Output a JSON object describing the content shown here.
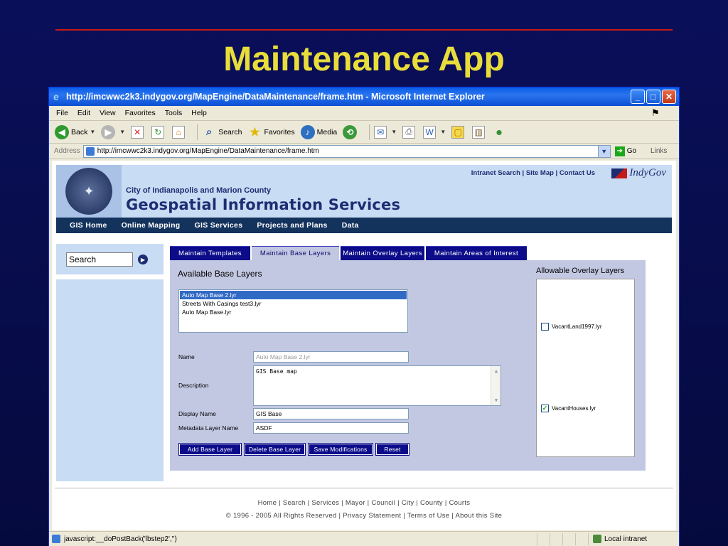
{
  "slide": {
    "title": "Maintenance App"
  },
  "window": {
    "title": "http://imcwwc2k3.indygov.org/MapEngine/DataMaintenance/frame.htm - Microsoft Internet Explorer"
  },
  "menu": {
    "items": [
      "File",
      "Edit",
      "View",
      "Favorites",
      "Tools",
      "Help"
    ]
  },
  "toolbar": {
    "back": "Back",
    "search": "Search",
    "favorites": "Favorites",
    "media": "Media"
  },
  "address": {
    "label": "Address",
    "url": "http://imcwwc2k3.indygov.org/MapEngine/DataMaintenance/frame.htm",
    "go": "Go",
    "links": "Links"
  },
  "site": {
    "top_links": "Intranet Search | Site Map | Contact Us",
    "brand": "IndyGov",
    "city": "City of Indianapolis and Marion County",
    "title": "Geospatial Information Services",
    "nav": [
      "GIS Home",
      "Online Mapping",
      "GIS Services",
      "Projects and Plans",
      "Data"
    ]
  },
  "search": {
    "value": "Search"
  },
  "tabs": [
    "Maintain Templates",
    "Maintain Base Layers",
    "Maintain Overlay Layers",
    "Maintain Areas of Interest"
  ],
  "base_layers": {
    "heading": "Available Base Layers",
    "items": [
      "Auto Map Base 2.lyr",
      "Streets With Casings test3.lyr",
      "Auto Map Base.lyr"
    ],
    "selected": "Auto Map Base 2.lyr"
  },
  "form": {
    "name_label": "Name",
    "name_value": "Auto Map Base 2.lyr",
    "description_label": "Description",
    "description_value": "GIS Base map",
    "display_label": "Display Name",
    "display_value": "GIS Base",
    "metadata_label": "Metadata Layer Name",
    "metadata_value": "ASDF"
  },
  "buttons": {
    "add": "Add Base Layer",
    "delete": "Delete Base Layer",
    "save": "Save Modifications",
    "reset": "Reset"
  },
  "overlay": {
    "heading": "Allowable Overlay Layers",
    "items": [
      {
        "label": "VacantLand1997.lyr",
        "checked": false
      },
      {
        "label": "VacantHouses.lyr",
        "checked": true
      }
    ]
  },
  "footer": {
    "links": "Home | Search | Services | Mayor | Council | City | County | Courts",
    "copyright": "© 1996 - 2005 All Rights Reserved | Privacy Statement | Terms of Use | About this Site"
  },
  "status": {
    "text": "javascript:__doPostBack('lbstep2','')",
    "zone": "Local intranet"
  }
}
